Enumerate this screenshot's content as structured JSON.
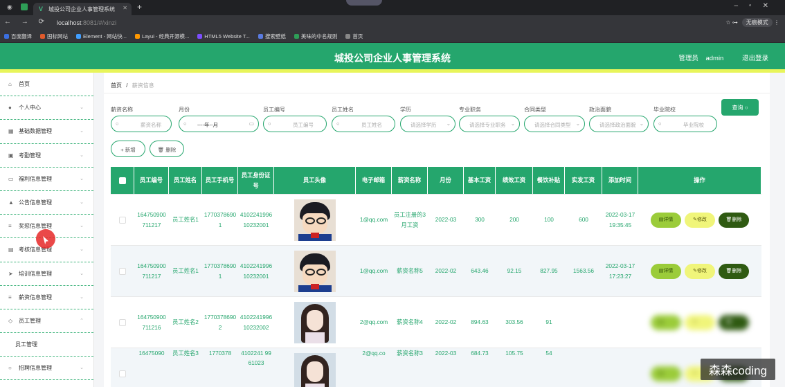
{
  "browser": {
    "tab_title": "城投公司企业人事管理系统",
    "url_host": "localhost",
    "url_rest": ":8081/#/xinzi",
    "profile_label": "无痕模式",
    "bookmarks": [
      "百度翻译",
      "国标网站",
      "Element - 网站快...",
      "Layui - 经典开源模...",
      "HTML5 Website T...",
      "搜索壁纸",
      "美味的中名规则",
      "首页"
    ],
    "bookmark_colors": [
      "#3b6fe0",
      "#e05a2b",
      "#409eff",
      "#ff9800",
      "#7c4dff",
      "#5a7be0",
      "#2e9e57",
      "#888888"
    ]
  },
  "header": {
    "title": "城投公司企业人事管理系统",
    "user": "管理员 admin",
    "logout": "退出登录"
  },
  "sidebar": {
    "items": [
      {
        "label": "首页",
        "icon": "home-icon",
        "glyph": "⌂"
      },
      {
        "label": "个人中心",
        "icon": "user-icon",
        "glyph": "●"
      },
      {
        "label": "基础数据管理",
        "icon": "grid-icon",
        "glyph": "▦"
      },
      {
        "label": "考勤管理",
        "icon": "calendar-icon",
        "glyph": "▣"
      },
      {
        "label": "福利信息管理",
        "icon": "message-icon",
        "glyph": "▭"
      },
      {
        "label": "公告信息管理",
        "icon": "notice-icon",
        "glyph": "▲"
      },
      {
        "label": "奖惩信息管理",
        "icon": "list-icon",
        "glyph": "≡"
      },
      {
        "label": "考核信息管理",
        "icon": "chart-icon",
        "glyph": "▤"
      },
      {
        "label": "培训信息管理",
        "icon": "send-icon",
        "glyph": "➤"
      },
      {
        "label": "薪资信息管理",
        "icon": "menu-icon",
        "glyph": "≡"
      },
      {
        "label": "员工管理",
        "icon": "shield-icon",
        "glyph": "◇"
      },
      {
        "label": "员工管理",
        "icon": "",
        "glyph": ""
      },
      {
        "label": "招聘信息管理",
        "icon": "circle-icon",
        "glyph": "○"
      }
    ]
  },
  "breadcrumb": {
    "home": "首页",
    "sep": "/",
    "current": "薪资信息"
  },
  "filters": [
    {
      "label": "薪资名称",
      "placeholder": "薪资名称",
      "type": "search"
    },
    {
      "label": "月份",
      "placeholder": "----年--月",
      "type": "month"
    },
    {
      "label": "员工编号",
      "placeholder": "员工编号",
      "type": "search"
    },
    {
      "label": "员工姓名",
      "placeholder": "员工姓名",
      "type": "search"
    },
    {
      "label": "学历",
      "placeholder": "请选择学历",
      "type": "select"
    },
    {
      "label": "专业职务",
      "placeholder": "请选择专业职务",
      "type": "select"
    },
    {
      "label": "合同类型",
      "placeholder": "请选择合同类型",
      "type": "select"
    },
    {
      "label": "政治面貌",
      "placeholder": "请选择政治面貌",
      "type": "select"
    },
    {
      "label": "毕业院校",
      "placeholder": "毕业院校",
      "type": "search"
    }
  ],
  "buttons": {
    "query": "查询",
    "add": "+ 新增",
    "delete": "删除"
  },
  "table": {
    "headers": [
      "员工编号",
      "员工姓名",
      "员工手机号",
      "员工身份证号",
      "员工头像",
      "电子邮箱",
      "薪资名称",
      "月份",
      "基本工资",
      "绩效工资",
      "餐饮补贴",
      "实发工资",
      "添加时间",
      "操作"
    ],
    "rows": [
      {
        "emp_no": "164750900711217",
        "name": "员工姓名1",
        "phone": "17703786901",
        "idcard": "410224199610232001",
        "avatar": "conan",
        "email": "1@qq.com",
        "salary_name": "员工注册的3月工资",
        "month": "2022-03",
        "base": "300",
        "perf": "200",
        "meal": "100",
        "actual": "600",
        "added": "2022-03-17 19:35:45"
      },
      {
        "emp_no": "164750900711217",
        "name": "员工姓名1",
        "phone": "17703786901",
        "idcard": "410224199610232001",
        "avatar": "conan",
        "email": "1@qq.com",
        "salary_name": "薪资名称5",
        "month": "2022-02",
        "base": "643.46",
        "perf": "92.15",
        "meal": "827.95",
        "actual": "1563.56",
        "added": "2022-03-17 17:23:27"
      },
      {
        "emp_no": "164750900711216",
        "name": "员工姓名2",
        "phone": "17703786902",
        "idcard": "410224199610232002",
        "avatar": "girl",
        "email": "2@qq.com",
        "salary_name": "薪资名称4",
        "month": "2022-02",
        "base": "894.63",
        "perf": "303.56",
        "meal": "91",
        "actual": "",
        "added": ""
      },
      {
        "emp_no": "16475090",
        "name": "员工姓名3",
        "phone": "1770378",
        "idcard": "4102241 9961023",
        "avatar": "girl",
        "email": "2@qq.co",
        "salary_name": "薪资名称3",
        "month": "2022-03",
        "base": "684.73",
        "perf": "105.75",
        "meal": "54",
        "actual": "",
        "added": ""
      }
    ],
    "actions": {
      "detail": "详情",
      "edit": "修改",
      "delete": "删除"
    }
  },
  "watermark": "森森coding"
}
